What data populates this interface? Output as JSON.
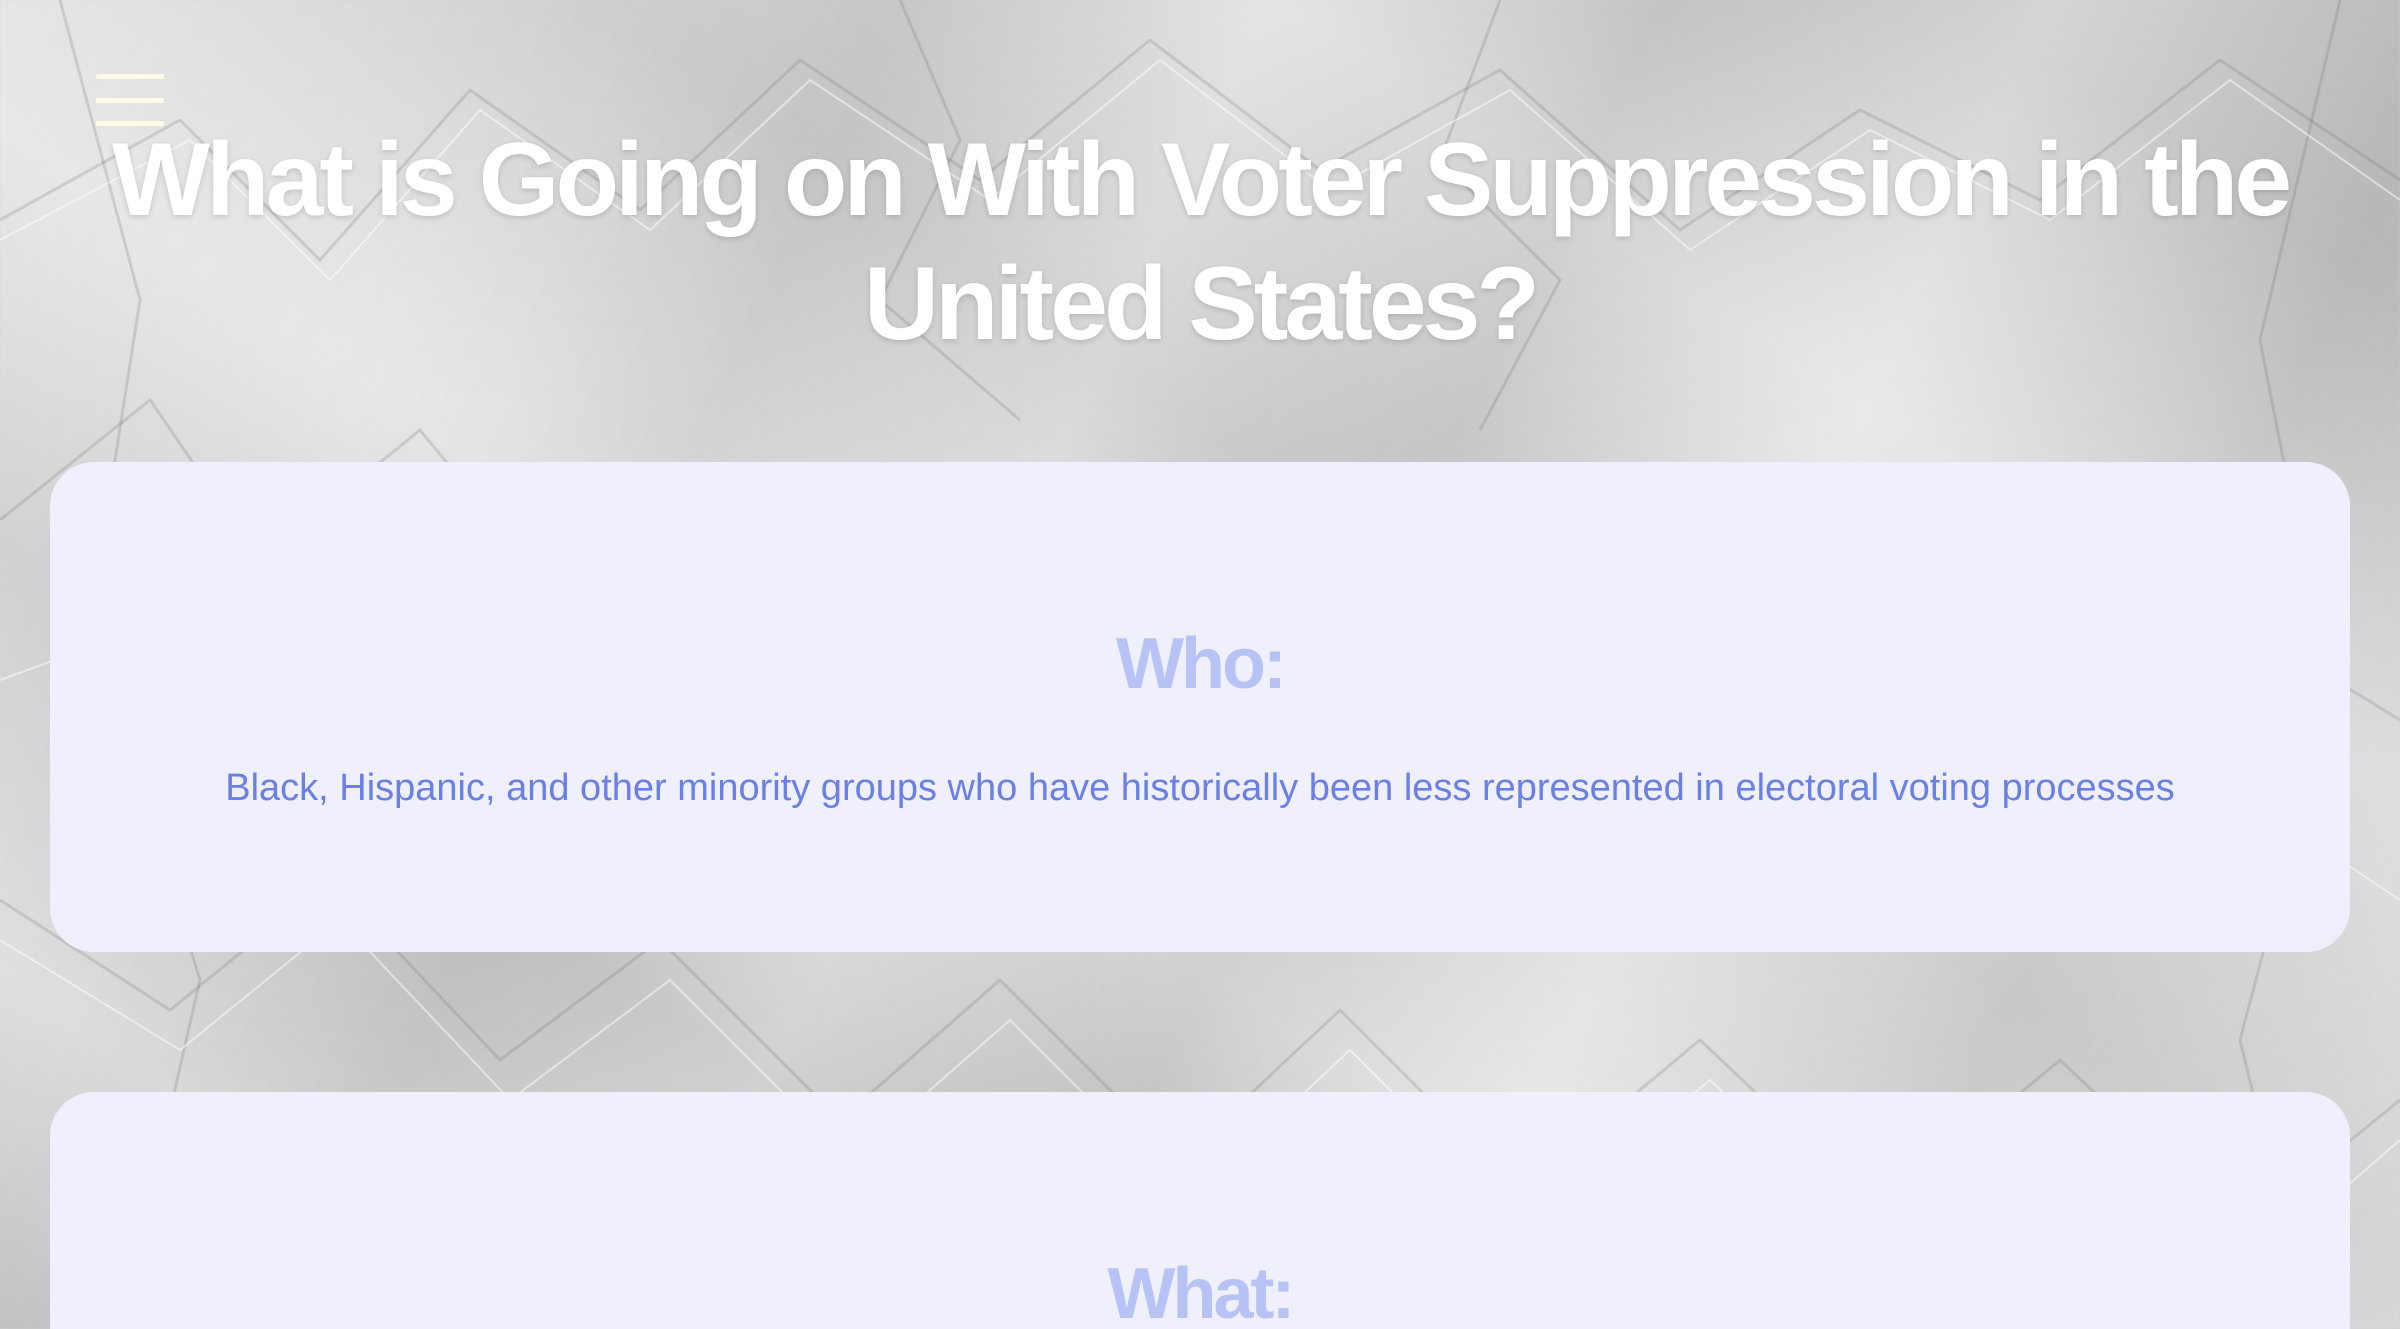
{
  "header": {
    "menu_icon": "hamburger-menu-icon",
    "title": "What is Going on With Voter Suppression in the United States?"
  },
  "cards": [
    {
      "heading": "Who:",
      "body": "Black, Hispanic, and other minority groups who have historically been less represented in electoral voting processes"
    },
    {
      "heading": "What:"
    }
  ],
  "colors": {
    "title": "#ffffff",
    "menu_icon": "#fffbe6",
    "card_background": "#eff0fc",
    "card_heading": "#b7c2f5",
    "card_body": "#6a80e4",
    "page_background": "#cfcfd1"
  }
}
